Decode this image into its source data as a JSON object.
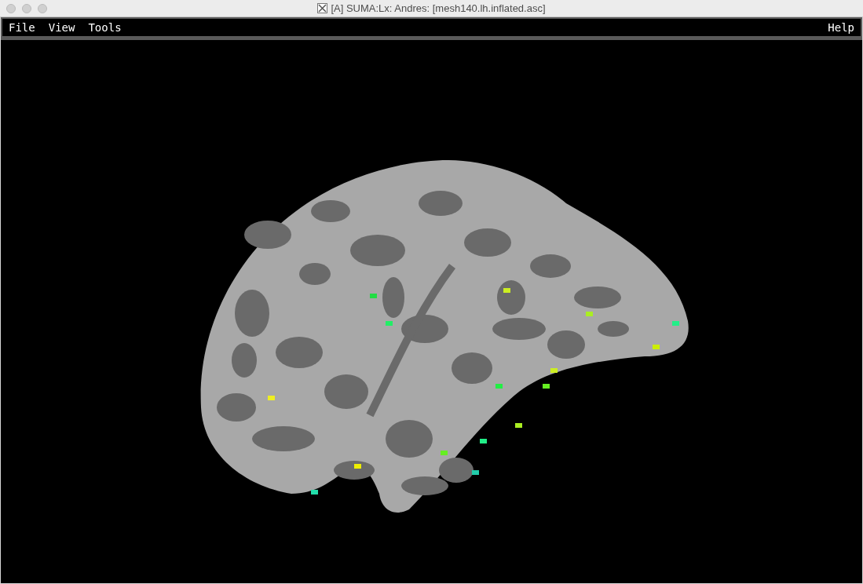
{
  "window": {
    "title": "[A] SUMA:Lx: Andres: [mesh140.lh.inflated.asc]"
  },
  "menu": {
    "left": [
      "File",
      "View",
      "Tools"
    ],
    "right": [
      "Help"
    ]
  }
}
